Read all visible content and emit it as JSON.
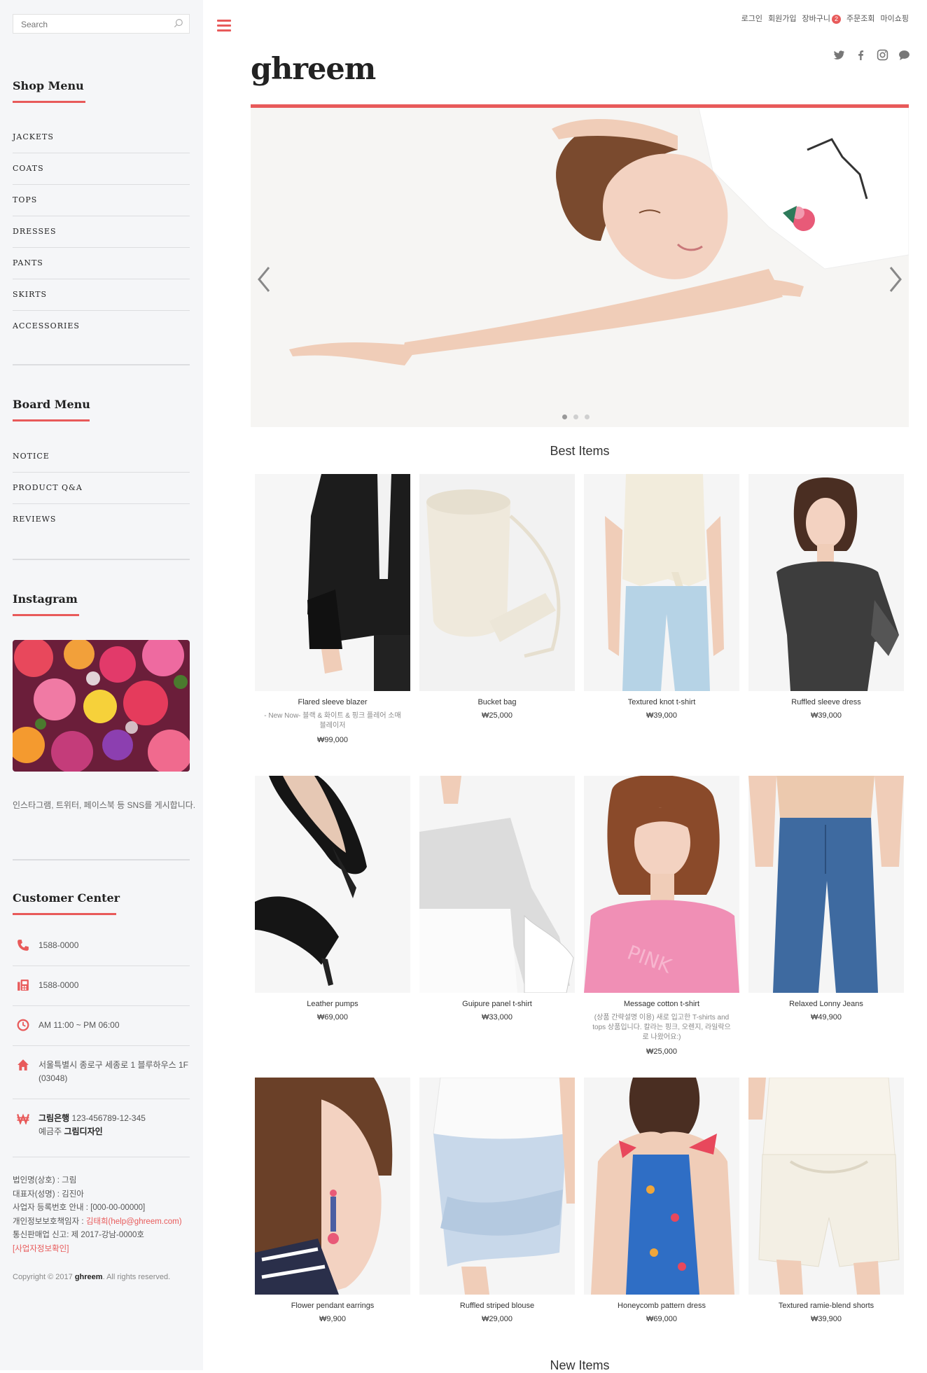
{
  "sidebar": {
    "search_placeholder": "Search",
    "shop_menu": {
      "title": "Shop Menu",
      "items": [
        "JACKETS",
        "COATS",
        "TOPS",
        "DRESSES",
        "PANTS",
        "SKIRTS",
        "ACCESSORIES"
      ]
    },
    "board_menu": {
      "title": "Board Menu",
      "items": [
        "NOTICE",
        "PRODUCT Q&A",
        "REVIEWS"
      ]
    },
    "instagram": {
      "title": "Instagram",
      "text": "인스타그램, 트위터, 페이스북 등 SNS를 게시합니다."
    },
    "customer_center": {
      "title": "Customer Center",
      "phone": "1588-0000",
      "fax": "1588-0000",
      "hours": "AM 11:00 ~ PM 06:00",
      "address_line1": "서울특별시 종로구 세종로 1 블루하우스 1F",
      "address_line2": "(03048)",
      "bank_name": "그림은행",
      "bank_account": "123-456789-12-345",
      "holder_label": "예금주",
      "holder_name": "그림디자인"
    },
    "business": {
      "company": "법인명(상호) : 그림",
      "ceo": "대표자(성명) : 김진아",
      "reg_no": "사업자 등록번호 안내 : [000-00-00000]",
      "privacy_label": "개인정보보호책임자 : ",
      "privacy_value": "김태희(help@ghreem.com)",
      "mail_order": "통신판매업 신고: 제 2017-강남-0000호",
      "check_link": "[사업자정보확인]"
    },
    "copyright_prefix": "Copyright © 2017 ",
    "copyright_brand": "ghreem",
    "copyright_suffix": ". All rights reserved."
  },
  "header": {
    "logo": "ghreem",
    "nav": {
      "login": "로그인",
      "join": "회원가입",
      "cart": "장바구니",
      "cart_count": "2",
      "orders": "주문조회",
      "mypage": "마이쇼핑"
    }
  },
  "slider": {
    "total_slides": 3,
    "active_slide": 1
  },
  "best_items": {
    "title": "Best Items",
    "products": [
      {
        "name": "Flared sleeve blazer",
        "desc": "- New Now- 블랙 & 화이트 & 핑크 플레어 소매 블레이저",
        "price": "₩99,000"
      },
      {
        "name": "Bucket bag",
        "desc": "",
        "price": "₩25,000"
      },
      {
        "name": "Textured knot t-shirt",
        "desc": "",
        "price": "₩39,000"
      },
      {
        "name": "Ruffled sleeve dress",
        "desc": "",
        "price": "₩39,000"
      },
      {
        "name": "Leather pumps",
        "desc": "",
        "price": "₩69,000"
      },
      {
        "name": "Guipure panel t-shirt",
        "desc": "",
        "price": "₩33,000"
      },
      {
        "name": "Message cotton t-shirt",
        "desc": "(상품 간략설명 이용) 새로 입고한 T-shirts and tops 상품입니다. 칼라는 핑크, 오렌지, 라일락으로 나왔어요:)",
        "price": "₩25,000"
      },
      {
        "name": "Relaxed Lonny Jeans",
        "desc": "",
        "price": "₩49,900"
      },
      {
        "name": "Flower pendant earrings",
        "desc": "",
        "price": "₩9,900"
      },
      {
        "name": "Ruffled striped blouse",
        "desc": "",
        "price": "₩29,000"
      },
      {
        "name": "Honeycomb pattern dress",
        "desc": "",
        "price": "₩69,000"
      },
      {
        "name": "Textured ramie-blend shorts",
        "desc": "",
        "price": "₩39,900"
      }
    ]
  },
  "new_items": {
    "title": "New Items"
  },
  "colors": {
    "accent": "#e85a5a",
    "sidebar_bg": "#f5f6f8"
  }
}
